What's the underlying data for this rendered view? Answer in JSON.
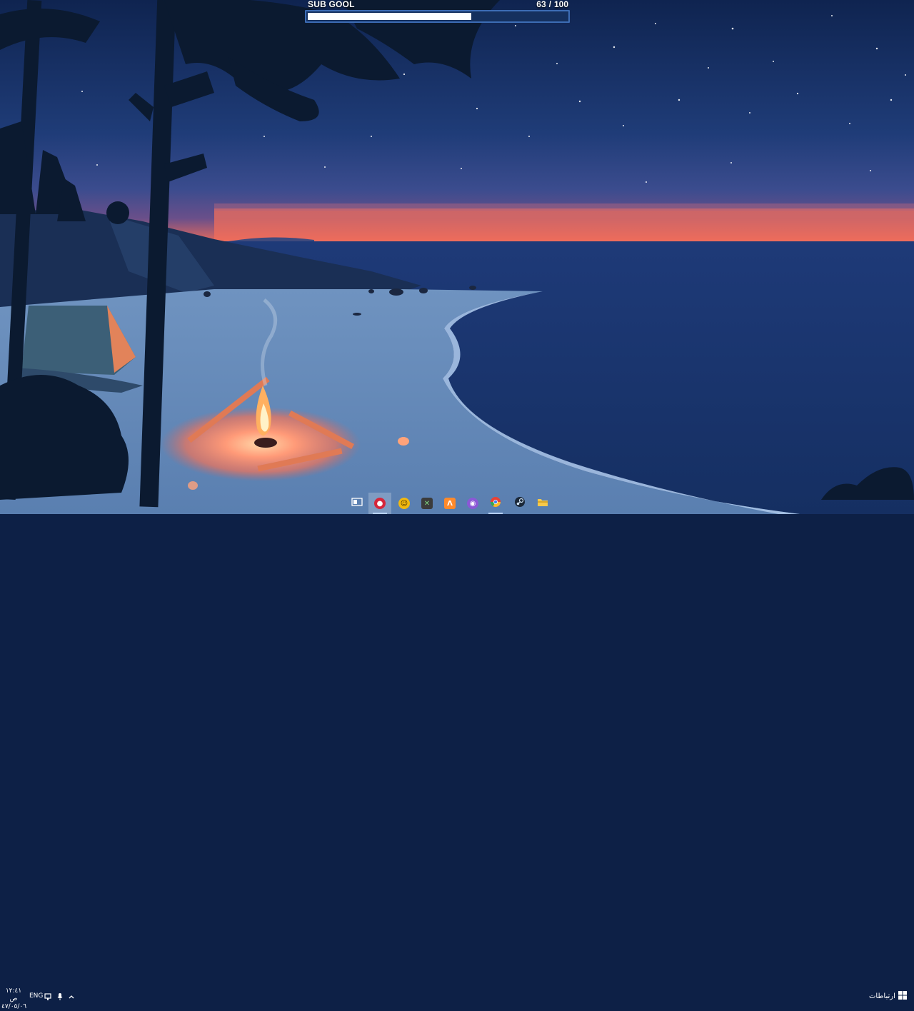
{
  "sub_goal": {
    "title": "SUB GOOL",
    "current": "63",
    "separator": "/",
    "target": "100",
    "progress": 0.63
  },
  "taskbar": {
    "apps": [
      {
        "name": "task-view-icon",
        "color": "#ffffff"
      },
      {
        "name": "streaming-app-icon",
        "color": "#d5263a"
      },
      {
        "name": "chat-app-icon",
        "color": "#f2b90f"
      },
      {
        "name": "terminal-app-icon",
        "color": "#3b3b3b"
      },
      {
        "name": "design-app-icon",
        "color": "#ff8a2b"
      },
      {
        "name": "voice-app-icon",
        "color": "#8b58d6"
      },
      {
        "name": "chrome-icon",
        "color": "#e94235"
      },
      {
        "name": "steam-icon",
        "color": "#1b2838"
      },
      {
        "name": "file-explorer-icon",
        "color": "#f8c94a"
      }
    ],
    "search_label": "ارتباطات",
    "language": "ENG",
    "time": "١٢:٤١ ص",
    "date": "٤٧/٠٥/٠٦"
  }
}
